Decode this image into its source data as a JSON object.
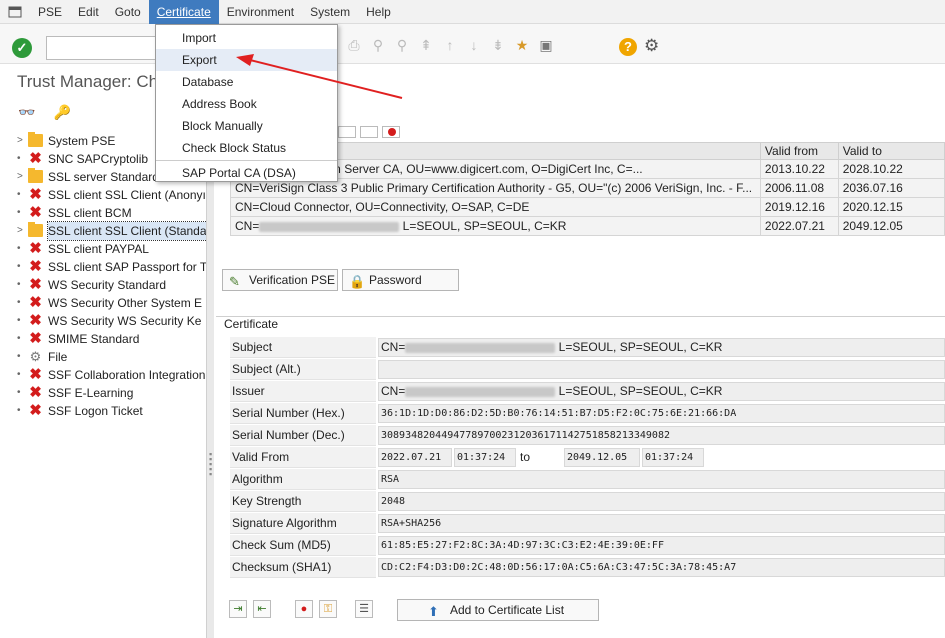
{
  "menu": {
    "items": [
      "PSE",
      "Edit",
      "Goto",
      "Certificate",
      "Environment",
      "System",
      "Help"
    ],
    "active_index": 3
  },
  "dropdown": {
    "items": [
      "Import",
      "Export",
      "Database",
      "Address Book",
      "Block Manually",
      "Check Block Status",
      "SAP Portal CA (DSA)"
    ],
    "highlighted_index": 1
  },
  "title": "Trust Manager: Ch",
  "tree": [
    {
      "label": "System PSE",
      "icon": "folder-icon",
      "expander": true
    },
    {
      "label": "SNC SAPCryptolib",
      "icon": "x-icon",
      "expander": false
    },
    {
      "label": "SSL server Standard",
      "icon": "folder-icon",
      "expander": true
    },
    {
      "label": "SSL client SSL Client (Anonyı",
      "icon": "x-icon",
      "expander": false
    },
    {
      "label": "SSL client BCM",
      "icon": "x-icon",
      "expander": false
    },
    {
      "label": "SSL client SSL Client (Standa",
      "icon": "folder-icon",
      "expander": true,
      "selected": true
    },
    {
      "label": "SSL client PAYPAL",
      "icon": "x-icon",
      "expander": false
    },
    {
      "label": "SSL client SAP Passport for T",
      "icon": "x-icon",
      "expander": false
    },
    {
      "label": "WS Security Standard",
      "icon": "x-icon",
      "expander": false
    },
    {
      "label": "WS Security Other System E",
      "icon": "x-icon",
      "expander": false
    },
    {
      "label": "WS Security WS Security Ke",
      "icon": "x-icon",
      "expander": false
    },
    {
      "label": "SMIME Standard",
      "icon": "x-icon",
      "expander": false
    },
    {
      "label": "File",
      "icon": "file-gear-icon",
      "expander": false
    },
    {
      "label": "SSF Collaboration Integration",
      "icon": "x-icon",
      "expander": false
    },
    {
      "label": "SSF E-Learning",
      "icon": "x-icon",
      "expander": false
    },
    {
      "label": "SSF Logon Ticket",
      "icon": "x-icon",
      "expander": false
    }
  ],
  "cert_table": {
    "headers": [
      "",
      "Valid from",
      "Valid to"
    ],
    "rows": [
      [
        "Extended Validation Server CA, OU=www.digicert.com, O=DigiCert Inc, C=...",
        "2013.10.22",
        "2028.10.22"
      ],
      [
        "CN=VeriSign Class 3 Public Primary Certification Authority - G5, OU=\"(c) 2006 VeriSign, Inc. - F...",
        "2006.11.08",
        "2036.07.16"
      ],
      [
        "CN=Cloud Connector, OU=Connectivity, O=SAP, C=DE",
        "2019.12.16",
        "2020.12.15"
      ],
      [
        "CN=",
        "2022.07.21",
        "2049.12.05"
      ]
    ],
    "row4_suffix": " L=SEOUL, SP=SEOUL, C=KR"
  },
  "buttons": {
    "verification": "Verification PSE",
    "password": "Password",
    "add_to_list": "Add to Certificate List"
  },
  "certificate": {
    "section_title": "Certificate",
    "labels": {
      "subject": "Subject",
      "subject_alt": "Subject (Alt.)",
      "issuer": "Issuer",
      "serial_hex": "Serial Number (Hex.)",
      "serial_dec": "Serial Number (Dec.)",
      "valid_from": "Valid From",
      "algorithm": "Algorithm",
      "key_strength": "Key Strength",
      "sig_algorithm": "Signature Algorithm",
      "checksum_md5": "Check Sum (MD5)",
      "checksum_sha1": "Checksum (SHA1)"
    },
    "subject_prefix": "CN=",
    "subject_suffix": " L=SEOUL, SP=SEOUL, C=KR",
    "subject_alt": "",
    "issuer_prefix": "CN=",
    "issuer_suffix": " L=SEOUL, SP=SEOUL, C=KR",
    "serial_hex": "36:1D:1D:D0:86:D2:5D:B0:76:14:51:B7:D5:F2:0C:75:6E:21:66:DA",
    "serial_dec": "308934820449477897002312036171142751858213349082",
    "valid_from_date": "2022.07.21",
    "valid_from_time": "01:37:24",
    "to_label": "to",
    "valid_to_date": "2049.12.05",
    "valid_to_time": "01:37:24",
    "algorithm": "RSA",
    "key_strength": "2048",
    "sig_algorithm": "RSA+SHA256",
    "checksum_md5": "61:85:E5:27:F2:8C:3A:4D:97:3C:C3:E2:4E:39:0E:FF",
    "checksum_sha1": "CD:C2:F4:D3:D0:2C:48:0D:56:17:0A:C5:6A:C3:47:5C:3A:78:45:A7"
  },
  "colors": {
    "menu_active": "#3f7bbf",
    "ok_green": "#2e9a3a",
    "error_red": "#d31c1c",
    "folder_yellow": "#f5b82e",
    "arrow_red": "#e02020"
  }
}
